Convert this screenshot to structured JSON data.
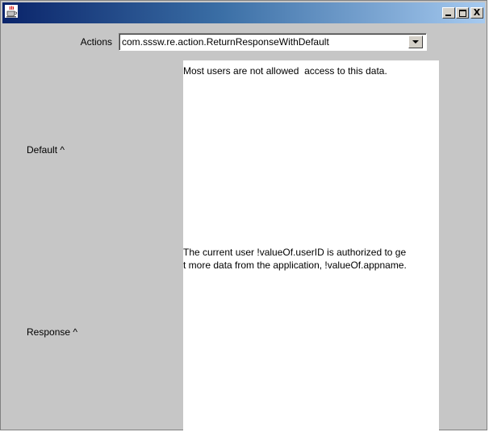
{
  "window": {
    "title": "",
    "icon": "java-cup-icon",
    "controls": {
      "minimize": "minimize-icon",
      "maximize": "maximize-icon",
      "close_label": "X"
    }
  },
  "actions": {
    "label": "Actions",
    "selected_value": "com.sssw.re.action.ReturnResponseWithDefault"
  },
  "default": {
    "label": "Default ^",
    "text": "Most users are not allowed  access to this data."
  },
  "response": {
    "label": "Response ^",
    "text": "The current user !valueOf.userID is authorized to ge\nt more data from the application, !valueOf.appname."
  }
}
